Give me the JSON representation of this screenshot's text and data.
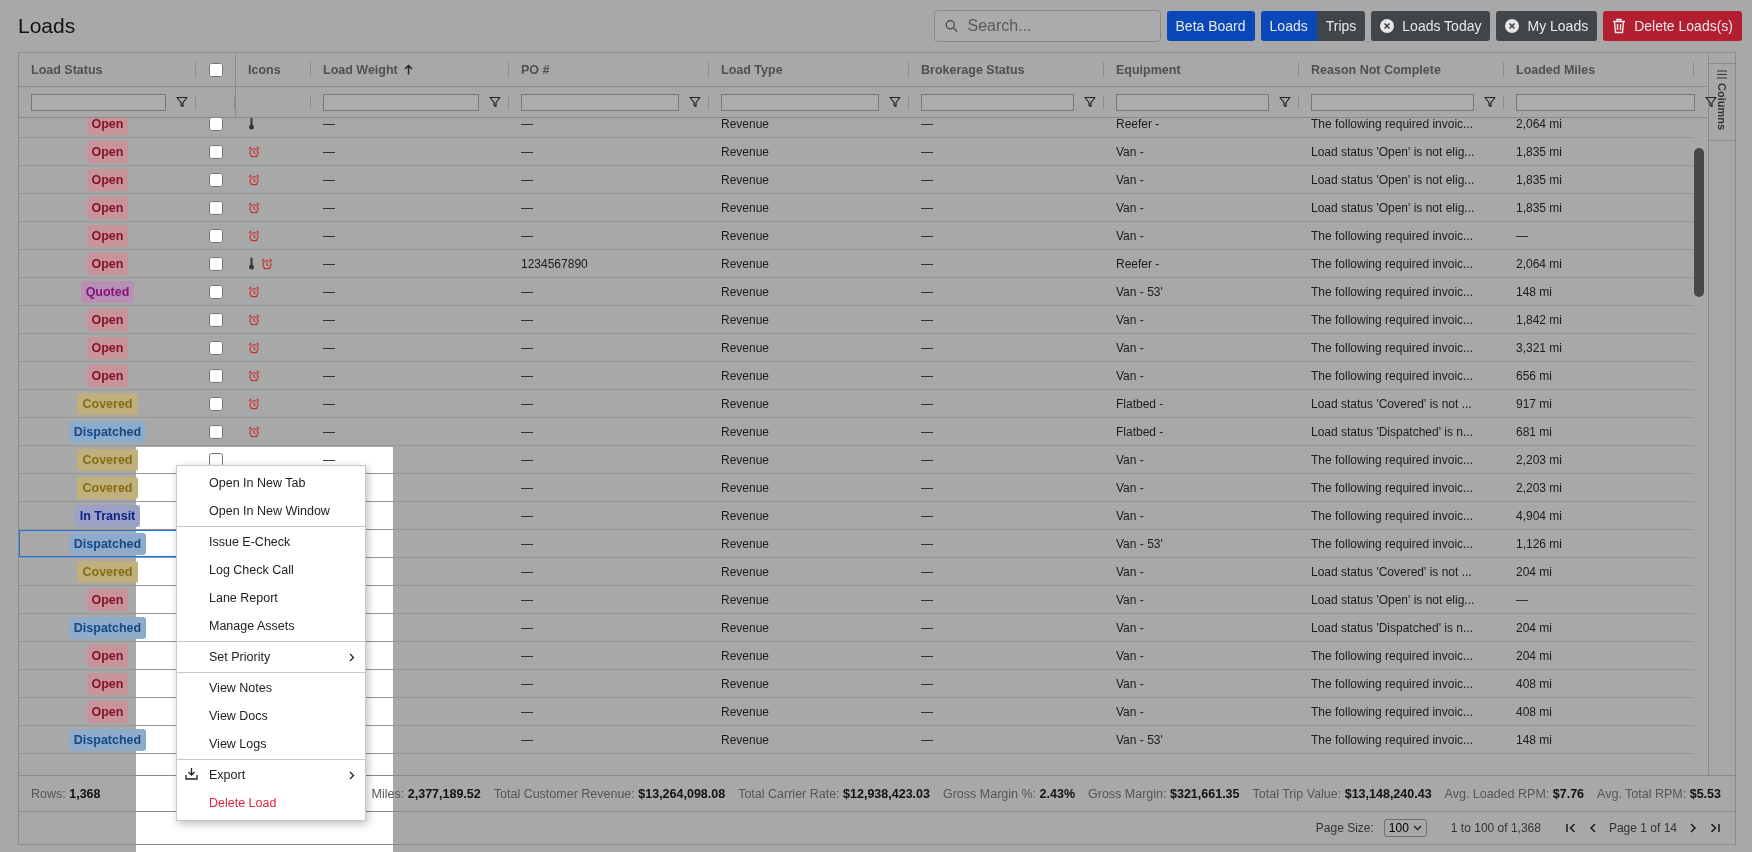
{
  "title": "Loads",
  "toolbar": {
    "search": {
      "placeholder": "Search..."
    },
    "beta_button": "Beta Board",
    "view_toggle": [
      {
        "label": "Loads",
        "selected": true
      },
      {
        "label": "Trips",
        "selected": false
      }
    ],
    "filter_buttons": [
      {
        "label": "Loads Today"
      },
      {
        "label": "My Loads"
      }
    ],
    "delete_button": "Delete Loads(s)"
  },
  "columns": [
    {
      "kind": "text",
      "label": "Load Status",
      "filter": true,
      "sorted_ascending": false
    },
    {
      "kind": "checkbox",
      "checked": false
    },
    {
      "kind": "text",
      "label": "Icons",
      "filter": false,
      "sorted_ascending": false
    },
    {
      "kind": "text",
      "label": "Load Weight",
      "filter": true,
      "sorted_ascending": true
    },
    {
      "kind": "text",
      "label": "PO #",
      "filter": true,
      "sorted_ascending": false
    },
    {
      "kind": "text",
      "label": "Load Type",
      "filter": true,
      "sorted_ascending": false
    },
    {
      "kind": "text",
      "label": "Brokerage Status",
      "filter": true,
      "sorted_ascending": false
    },
    {
      "kind": "text",
      "label": "Equipment",
      "filter": true,
      "sorted_ascending": false
    },
    {
      "kind": "text",
      "label": "Reason Not Complete",
      "filter": true,
      "sorted_ascending": false
    },
    {
      "kind": "text",
      "label": "Loaded Miles",
      "filter": true,
      "sorted_ascending": false
    }
  ],
  "rows": [
    {
      "status": "Open",
      "color": "#c8939b",
      "checked": false,
      "focused": false,
      "icons": [
        {
          "kind": "thermometer"
        }
      ],
      "weight": "—",
      "po": "—",
      "type": "Revenue",
      "brokerage": "—",
      "equipment": "Reefer -",
      "reason": "The following required invoic...",
      "miles": "2,064 mi"
    },
    {
      "status": "Open",
      "color": "#c8939b",
      "checked": false,
      "focused": false,
      "icons": [
        {
          "kind": "alarm"
        }
      ],
      "weight": "—",
      "po": "—",
      "type": "Revenue",
      "brokerage": "—",
      "equipment": "Van -",
      "reason": "Load status 'Open' is not elig...",
      "miles": "1,835 mi"
    },
    {
      "status": "Open",
      "color": "#c8939b",
      "checked": false,
      "focused": false,
      "icons": [
        {
          "kind": "alarm"
        }
      ],
      "weight": "—",
      "po": "—",
      "type": "Revenue",
      "brokerage": "—",
      "equipment": "Van -",
      "reason": "Load status 'Open' is not elig...",
      "miles": "1,835 mi"
    },
    {
      "status": "Open",
      "color": "#c8939b",
      "checked": false,
      "focused": false,
      "icons": [
        {
          "kind": "alarm"
        }
      ],
      "weight": "—",
      "po": "—",
      "type": "Revenue",
      "brokerage": "—",
      "equipment": "Van -",
      "reason": "Load status 'Open' is not elig...",
      "miles": "1,835 mi"
    },
    {
      "status": "Open",
      "color": "#c8939b",
      "checked": false,
      "focused": false,
      "icons": [
        {
          "kind": "alarm"
        }
      ],
      "weight": "—",
      "po": "—",
      "type": "Revenue",
      "brokerage": "—",
      "equipment": "Van -",
      "reason": "The following required invoic...",
      "miles": "—"
    },
    {
      "status": "Open",
      "color": "#c8939b",
      "checked": false,
      "focused": false,
      "icons": [
        {
          "kind": "thermometer"
        },
        {
          "kind": "alarm"
        }
      ],
      "weight": "—",
      "po": "1234567890",
      "type": "Revenue",
      "brokerage": "—",
      "equipment": "Reefer -",
      "reason": "The following required invoic...",
      "miles": "2,064 mi"
    },
    {
      "status": "Quoted",
      "color": "#b98fb6",
      "checked": false,
      "focused": false,
      "icons": [
        {
          "kind": "alarm"
        }
      ],
      "weight": "—",
      "po": "—",
      "type": "Revenue",
      "brokerage": "—",
      "equipment": "Van - 53'",
      "reason": "The following required invoic...",
      "miles": "148 mi"
    },
    {
      "status": "Open",
      "color": "#c8939b",
      "checked": false,
      "focused": false,
      "icons": [
        {
          "kind": "alarm"
        }
      ],
      "weight": "—",
      "po": "—",
      "type": "Revenue",
      "brokerage": "—",
      "equipment": "Van -",
      "reason": "The following required invoic...",
      "miles": "1,842 mi"
    },
    {
      "status": "Open",
      "color": "#c8939b",
      "checked": false,
      "focused": false,
      "icons": [
        {
          "kind": "alarm"
        }
      ],
      "weight": "—",
      "po": "—",
      "type": "Revenue",
      "brokerage": "—",
      "equipment": "Van -",
      "reason": "The following required invoic...",
      "miles": "3,321 mi"
    },
    {
      "status": "Open",
      "color": "#c8939b",
      "checked": false,
      "focused": false,
      "icons": [
        {
          "kind": "alarm"
        }
      ],
      "weight": "—",
      "po": "—",
      "type": "Revenue",
      "brokerage": "—",
      "equipment": "Van -",
      "reason": "The following required invoic...",
      "miles": "656 mi"
    },
    {
      "status": "Covered",
      "color": "#bfb07c",
      "checked": false,
      "focused": false,
      "icons": [
        {
          "kind": "alarm"
        }
      ],
      "weight": "—",
      "po": "—",
      "type": "Revenue",
      "brokerage": "—",
      "equipment": "Flatbed -",
      "reason": "Load status 'Covered' is not ...",
      "miles": "917 mi"
    },
    {
      "status": "Dispatched",
      "color": "#8fabcb",
      "checked": false,
      "focused": false,
      "icons": [
        {
          "kind": "alarm"
        }
      ],
      "weight": "—",
      "po": "—",
      "type": "Revenue",
      "brokerage": "—",
      "equipment": "Flatbed -",
      "reason": "Load status 'Dispatched' is n...",
      "miles": "681 mi"
    },
    {
      "status": "Covered",
      "color": "#bfb07c",
      "checked": false,
      "focused": false,
      "weight": "—",
      "po": "—",
      "type": "Revenue",
      "brokerage": "—",
      "equipment": "Van -",
      "reason": "The following required invoic...",
      "miles": "2,203 mi"
    },
    {
      "status": "Covered",
      "color": "#bfb07c",
      "focused": false,
      "po": "—",
      "type": "Revenue",
      "brokerage": "—",
      "equipment": "Van -",
      "reason": "The following required invoic...",
      "miles": "2,203 mi"
    },
    {
      "status": "In Transit",
      "color": "#9aa0c6",
      "focused": false,
      "po": "—",
      "type": "Revenue",
      "brokerage": "—",
      "equipment": "Van -",
      "reason": "The following required invoic...",
      "miles": "4,904 mi"
    },
    {
      "status": "Dispatched",
      "color": "#8fabcb",
      "focused": true,
      "po": "—",
      "type": "Revenue",
      "brokerage": "—",
      "equipment": "Van - 53'",
      "reason": "The following required invoic...",
      "miles": "1,126 mi"
    },
    {
      "status": "Covered",
      "color": "#bfb07c",
      "focused": false,
      "po": "—",
      "type": "Revenue",
      "brokerage": "—",
      "equipment": "Van -",
      "reason": "Load status 'Covered' is not ...",
      "miles": "204 mi"
    },
    {
      "status": "Open",
      "color": "#c8939b",
      "focused": false,
      "po": "—",
      "type": "Revenue",
      "brokerage": "—",
      "equipment": "Van -",
      "reason": "Load status 'Open' is not elig...",
      "miles": "—"
    },
    {
      "status": "Dispatched",
      "color": "#8fabcb",
      "focused": false,
      "po": "—",
      "type": "Revenue",
      "brokerage": "—",
      "equipment": "Van -",
      "reason": "Load status 'Dispatched' is n...",
      "miles": "204 mi"
    },
    {
      "status": "Open",
      "color": "#c8939b",
      "focused": false,
      "po": "—",
      "type": "Revenue",
      "brokerage": "—",
      "equipment": "Van -",
      "reason": "The following required invoic...",
      "miles": "204 mi"
    },
    {
      "status": "Open",
      "color": "#c8939b",
      "focused": false,
      "po": "—",
      "type": "Revenue",
      "brokerage": "—",
      "equipment": "Van -",
      "reason": "The following required invoic...",
      "miles": "408 mi"
    },
    {
      "status": "Open",
      "color": "#c8939b",
      "focused": false,
      "po": "—",
      "type": "Revenue",
      "brokerage": "—",
      "equipment": "Van -",
      "reason": "The following required invoic...",
      "miles": "408 mi"
    },
    {
      "status": "Dispatched",
      "color": "#8fabcb",
      "focused": false,
      "po": "—",
      "type": "Revenue",
      "brokerage": "—",
      "equipment": "Van - 53'",
      "reason": "The following required invoic...",
      "miles": "148 mi"
    }
  ],
  "side_tab": "Columns",
  "summary": {
    "rows": {
      "label": "Rows:",
      "value": "1,368"
    },
    "totals": [
      {
        "label": "Miles:",
        "value": "2,377,189.52"
      },
      {
        "label": "Total Customer Revenue:",
        "value": "$13,264,098.08"
      },
      {
        "label": "Total Carrier Rate:",
        "value": "$12,938,423.03"
      },
      {
        "label": "Gross Margin %:",
        "value": "2.43%"
      },
      {
        "label": "Gross Margin:",
        "value": "$321,661.35"
      },
      {
        "label": "Total Trip Value:",
        "value": "$13,148,240.43"
      },
      {
        "label": "Avg. Loaded RPM:",
        "value": "$7.76"
      },
      {
        "label": "Avg. Total RPM:",
        "value": "$5.53"
      }
    ]
  },
  "pagination": {
    "page_size_label": "Page Size:",
    "page_size": "100",
    "range": "1 to 100 of 1,368",
    "page": "Page 1 of 14"
  },
  "context_menu": {
    "groups": [
      [
        {
          "label": "Open In New Tab",
          "kind": "plain"
        },
        {
          "label": "Open In New Window",
          "kind": "plain"
        }
      ],
      [
        {
          "label": "Issue E-Check",
          "kind": "plain"
        },
        {
          "label": "Log Check Call",
          "kind": "plain"
        },
        {
          "label": "Lane Report",
          "kind": "plain"
        },
        {
          "label": "Manage Assets",
          "kind": "plain"
        }
      ],
      [
        {
          "label": "Set Priority",
          "kind": "submenu"
        }
      ],
      [
        {
          "label": "View Notes",
          "kind": "plain"
        },
        {
          "label": "View Docs",
          "kind": "plain"
        },
        {
          "label": "View Logs",
          "kind": "plain"
        }
      ],
      [
        {
          "label": "Export",
          "kind": "export"
        },
        {
          "label": "Delete Load",
          "kind": "danger"
        }
      ]
    ]
  }
}
